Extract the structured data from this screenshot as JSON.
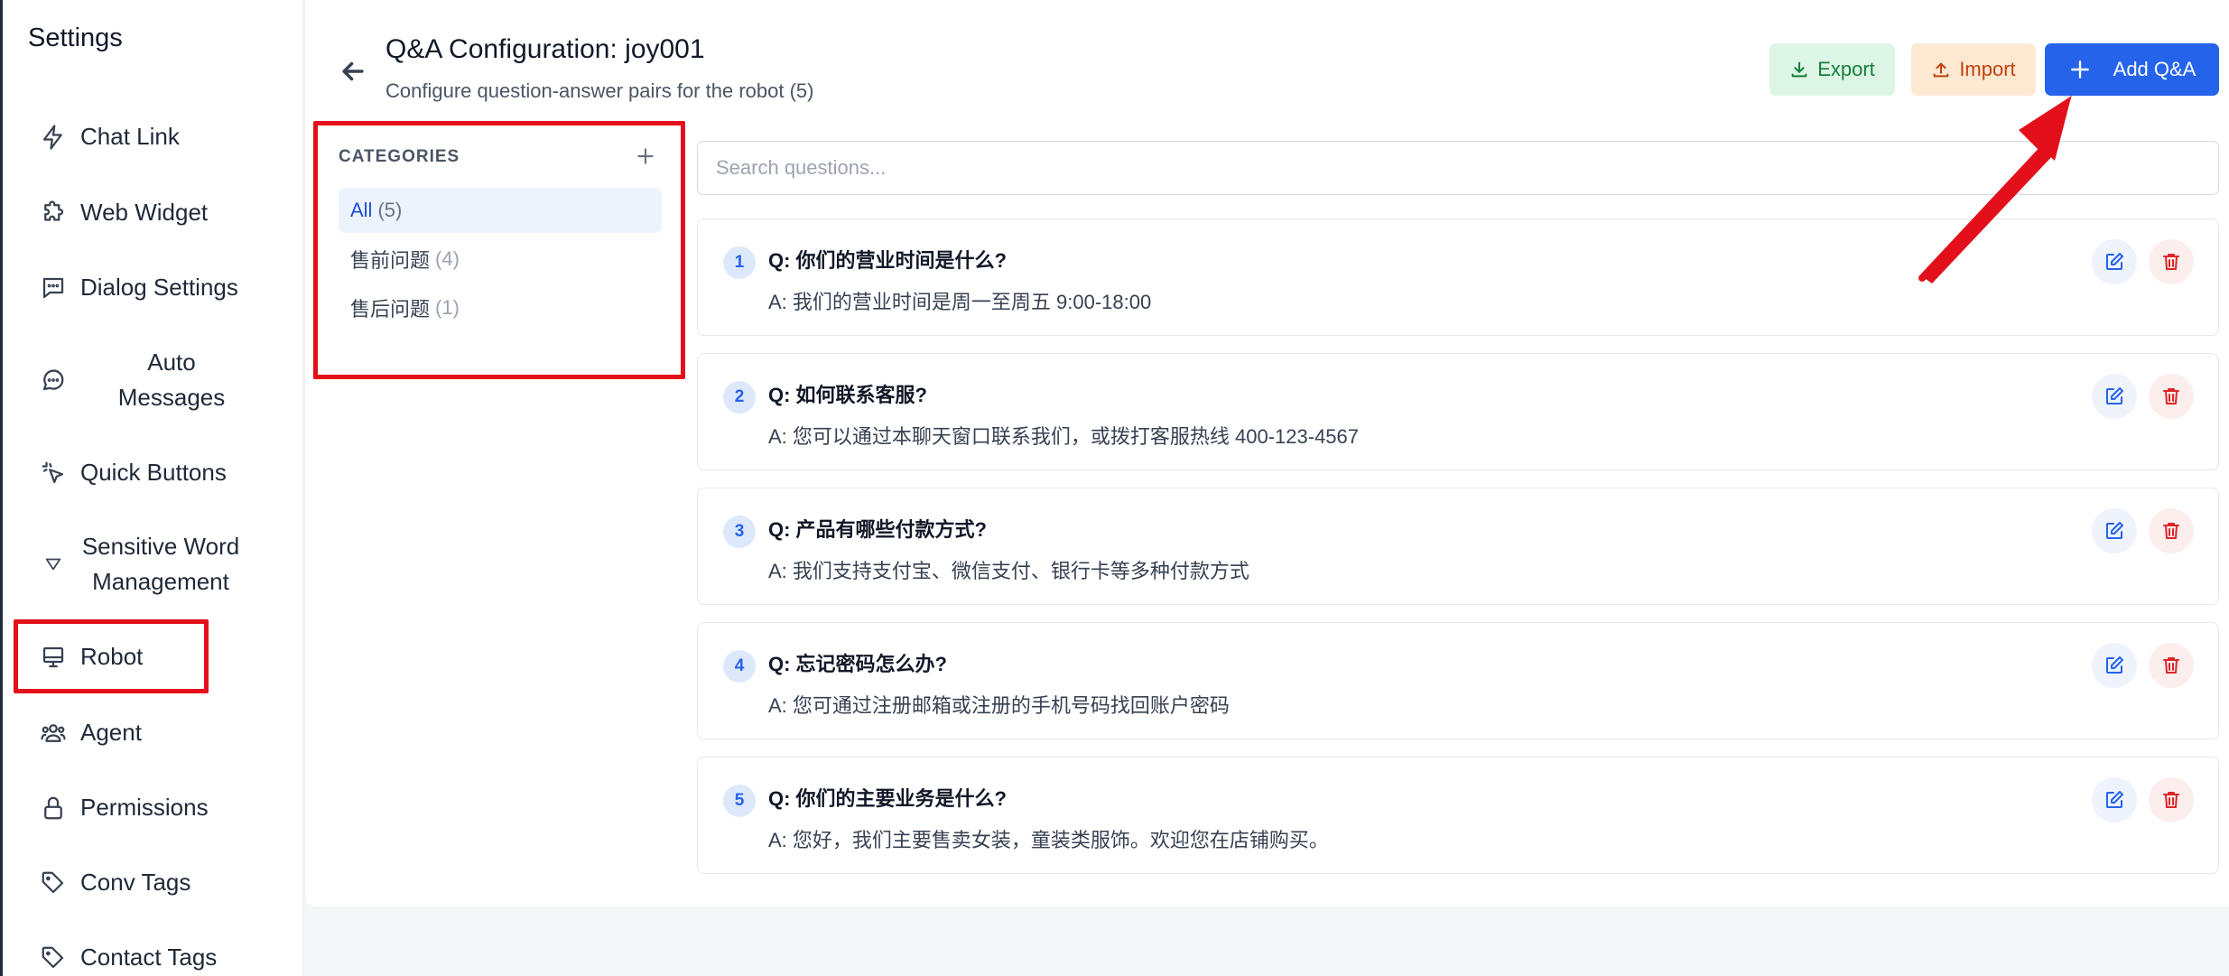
{
  "sidebar": {
    "title": "Settings",
    "items": [
      {
        "label": "Chat Link",
        "icon": "bolt-icon"
      },
      {
        "label": "Web Widget",
        "icon": "puzzle-icon"
      },
      {
        "label": "Dialog Settings",
        "icon": "message-square-icon"
      },
      {
        "label": "Auto Messages",
        "icon": "message-circle-icon"
      },
      {
        "label": "Quick Buttons",
        "icon": "pointer-click-icon"
      },
      {
        "label": "Sensitive Word Management",
        "icon": "triangle-filter-icon"
      },
      {
        "label": "Robot",
        "icon": "monitor-icon"
      },
      {
        "label": "Agent",
        "icon": "users-icon"
      },
      {
        "label": "Permissions",
        "icon": "lock-icon"
      },
      {
        "label": "Conv Tags",
        "icon": "tag-icon"
      },
      {
        "label": "Contact Tags",
        "icon": "tag-icon"
      }
    ],
    "auto_messages_line1": "Auto",
    "auto_messages_line2": "Messages",
    "sensitive_line1": "Sensitive Word",
    "sensitive_line2": "Management"
  },
  "header": {
    "title": "Q&A Configuration: joy001",
    "subtitle": "Configure question-answer pairs for the robot (5)",
    "export_label": "Export",
    "import_label": "Import",
    "add_label": "Add Q&A"
  },
  "categories": {
    "header": "CATEGORIES",
    "items": [
      {
        "label": "All",
        "count": "(5)",
        "active": true
      },
      {
        "label": "售前问题",
        "count": "(4)",
        "active": false
      },
      {
        "label": "售后问题",
        "count": "(1)",
        "active": false
      }
    ]
  },
  "search": {
    "placeholder": "Search questions...",
    "value": ""
  },
  "qa_list": [
    {
      "num": "1",
      "question": "Q: 你们的营业时间是什么?",
      "answer": "A: 我们的营业时间是周一至周五 9:00-18:00"
    },
    {
      "num": "2",
      "question": "Q: 如何联系客服?",
      "answer": "A: 您可以通过本聊天窗口联系我们，或拨打客服热线 400-123-4567"
    },
    {
      "num": "3",
      "question": "Q: 产品有哪些付款方式?",
      "answer": "A: 我们支持支付宝、微信支付、银行卡等多种付款方式"
    },
    {
      "num": "4",
      "question": "Q: 忘记密码怎么办?",
      "answer": "A: 您可通过注册邮箱或注册的手机号码找回账户密码"
    },
    {
      "num": "5",
      "question": "Q: 你们的主要业务是什么?",
      "answer": "A: 您好，我们主要售卖女装，童装类服饰。欢迎您在店铺购买。"
    }
  ],
  "colors": {
    "primary": "#2563eb",
    "export_bg": "#dcf5e4",
    "import_bg": "#fde8d2",
    "annotation_red": "#e3101b"
  }
}
